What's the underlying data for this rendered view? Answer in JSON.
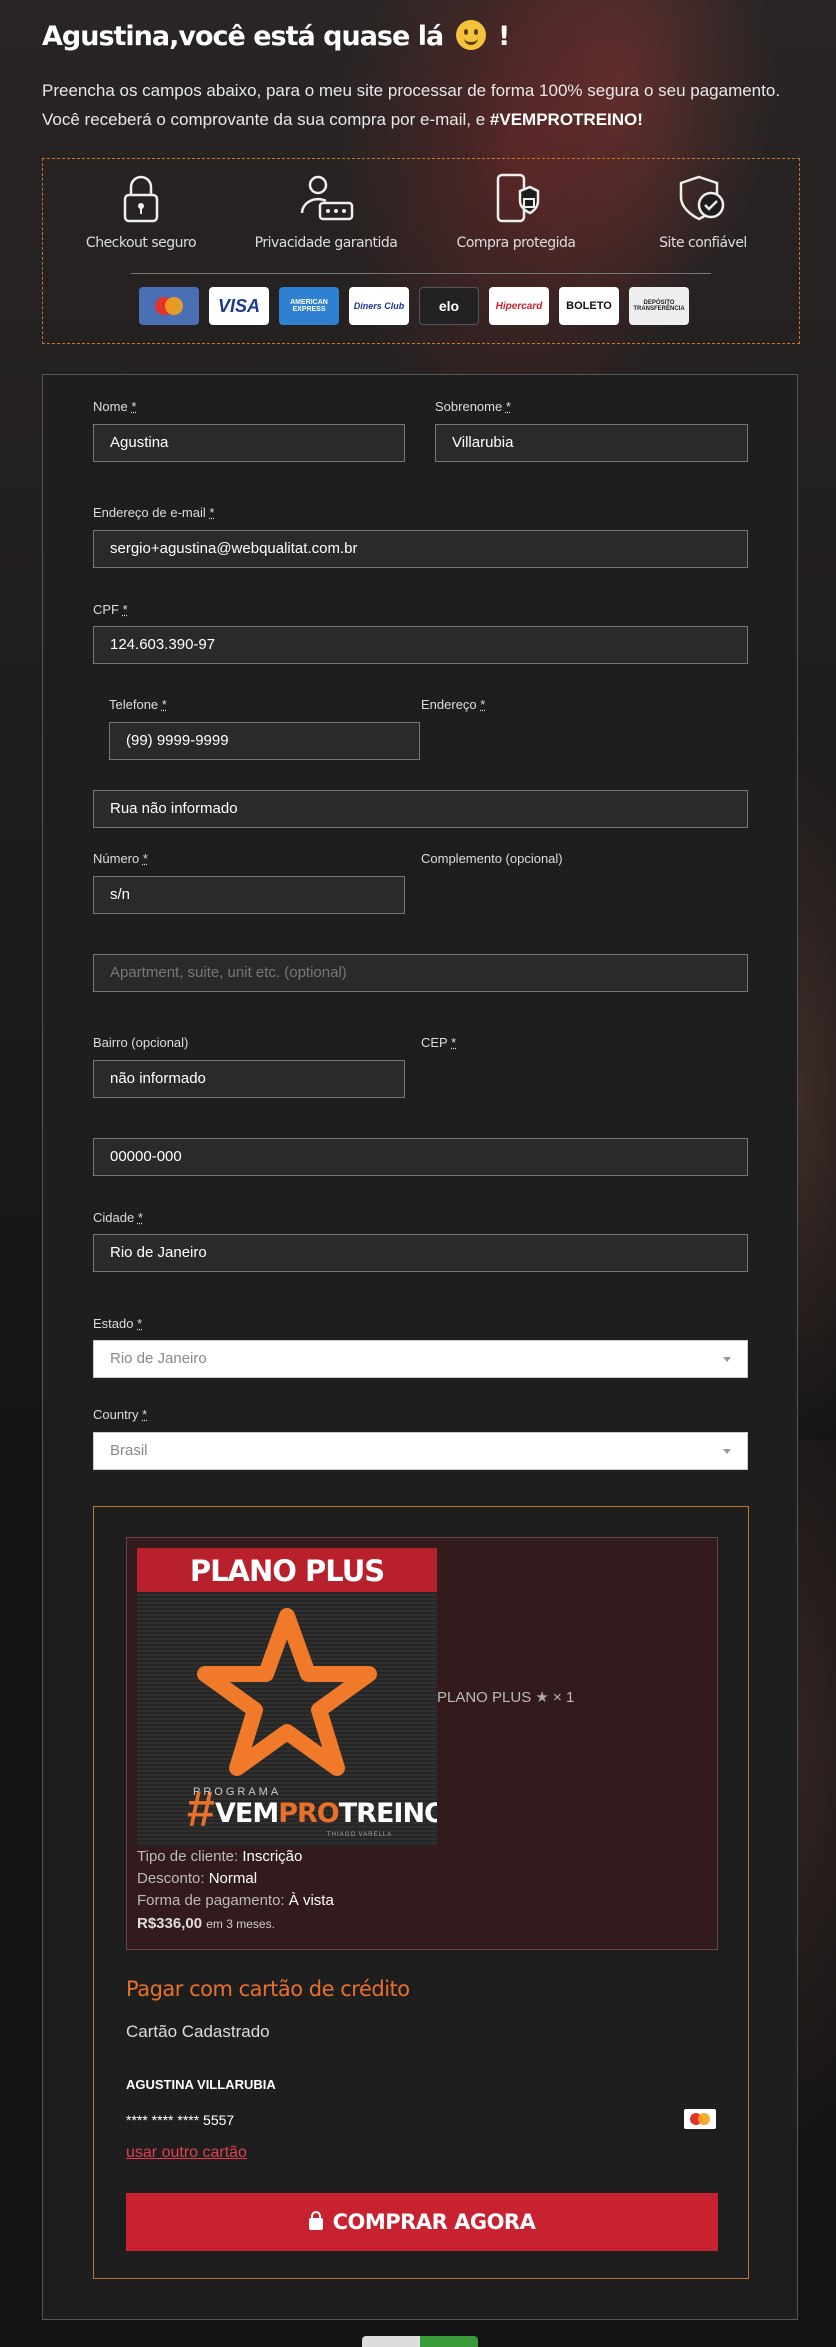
{
  "header": {
    "title": "Agustina,você está quase lá",
    "title_suffix": "!",
    "intro_line1": "Preencha os campos abaixo, para o meu site processar de forma 100% segura o seu pagamento.",
    "intro_line2": "Você receberá o comprovante da sua compra por e-mail, e ",
    "intro_hashtag": "#VEMPROTREINO!"
  },
  "trust": {
    "items": [
      {
        "label": "Checkout seguro",
        "icon": "padlock-icon"
      },
      {
        "label": "Privacidade garantida",
        "icon": "privacy-user-icon"
      },
      {
        "label": "Compra protegida",
        "icon": "protected-phone-icon"
      },
      {
        "label": "Site confiável",
        "icon": "shield-check-icon"
      }
    ],
    "cards": [
      "MasterCard",
      "VISA",
      "AMERICAN EXPRESS",
      "Diners Club",
      "elo",
      "Hipercard",
      "BOLETO",
      "DEPÓSITO TRANSFERÊNCIA"
    ]
  },
  "form": {
    "nome": {
      "label": "Nome",
      "value": "Agustina"
    },
    "sobrenome": {
      "label": "Sobrenome",
      "value": "Villarubia"
    },
    "email": {
      "label": "Endereço de e-mail",
      "value": "sergio+agustina@webqualitat.com.br"
    },
    "cpf": {
      "label": "CPF",
      "value": "124.603.390-97"
    },
    "telefone": {
      "label": "Telefone",
      "value": "(99) 9999-9999"
    },
    "endereco": {
      "label": "Endereço",
      "value": "Rua não informado"
    },
    "numero": {
      "label": "Número",
      "value": "s/n"
    },
    "complemento": {
      "label": "Complemento (opcional)",
      "placeholder": "Apartment, suite, unit etc. (optional)"
    },
    "bairro": {
      "label": "Bairro (opcional)",
      "value": "não informado"
    },
    "cep": {
      "label": "CEP",
      "value": "00000-000"
    },
    "cidade": {
      "label": "Cidade",
      "value": "Rio de Janeiro"
    },
    "estado": {
      "label": "Estado",
      "value": "Rio de Janeiro"
    },
    "country": {
      "label": "Country",
      "value": "Brasil"
    },
    "required_mark": "*"
  },
  "order": {
    "image_banner": "PLANO PLUS",
    "image_program": "PROGRAMA",
    "image_hash": "#",
    "image_vem": "VEM",
    "image_pro": "PRO",
    "image_treino": "TREINO",
    "image_author": "THIAGO VARELLA",
    "product_name": "PLANO PLUS",
    "product_qty": "× 1",
    "tipo_label": "Tipo de cliente:",
    "tipo_value": "Inscrição",
    "desconto_label": "Desconto:",
    "desconto_value": "Normal",
    "forma_label": "Forma de pagamento:",
    "forma_value": "À vista",
    "price": "R$336,00",
    "price_note": "em 3 meses."
  },
  "payment": {
    "title": "Pagar com cartão de crédito",
    "saved_label": "Cartão Cadastrado",
    "holder": "AGUSTINA VILLARUBIA",
    "card_number": "**** **** **** 5557",
    "other_card_link": "usar outro cartão",
    "buy_button": "COMPRAR AGORA"
  },
  "colors": {
    "accent": "#e8702a",
    "buy": "#c8212f",
    "link": "#e04050"
  }
}
